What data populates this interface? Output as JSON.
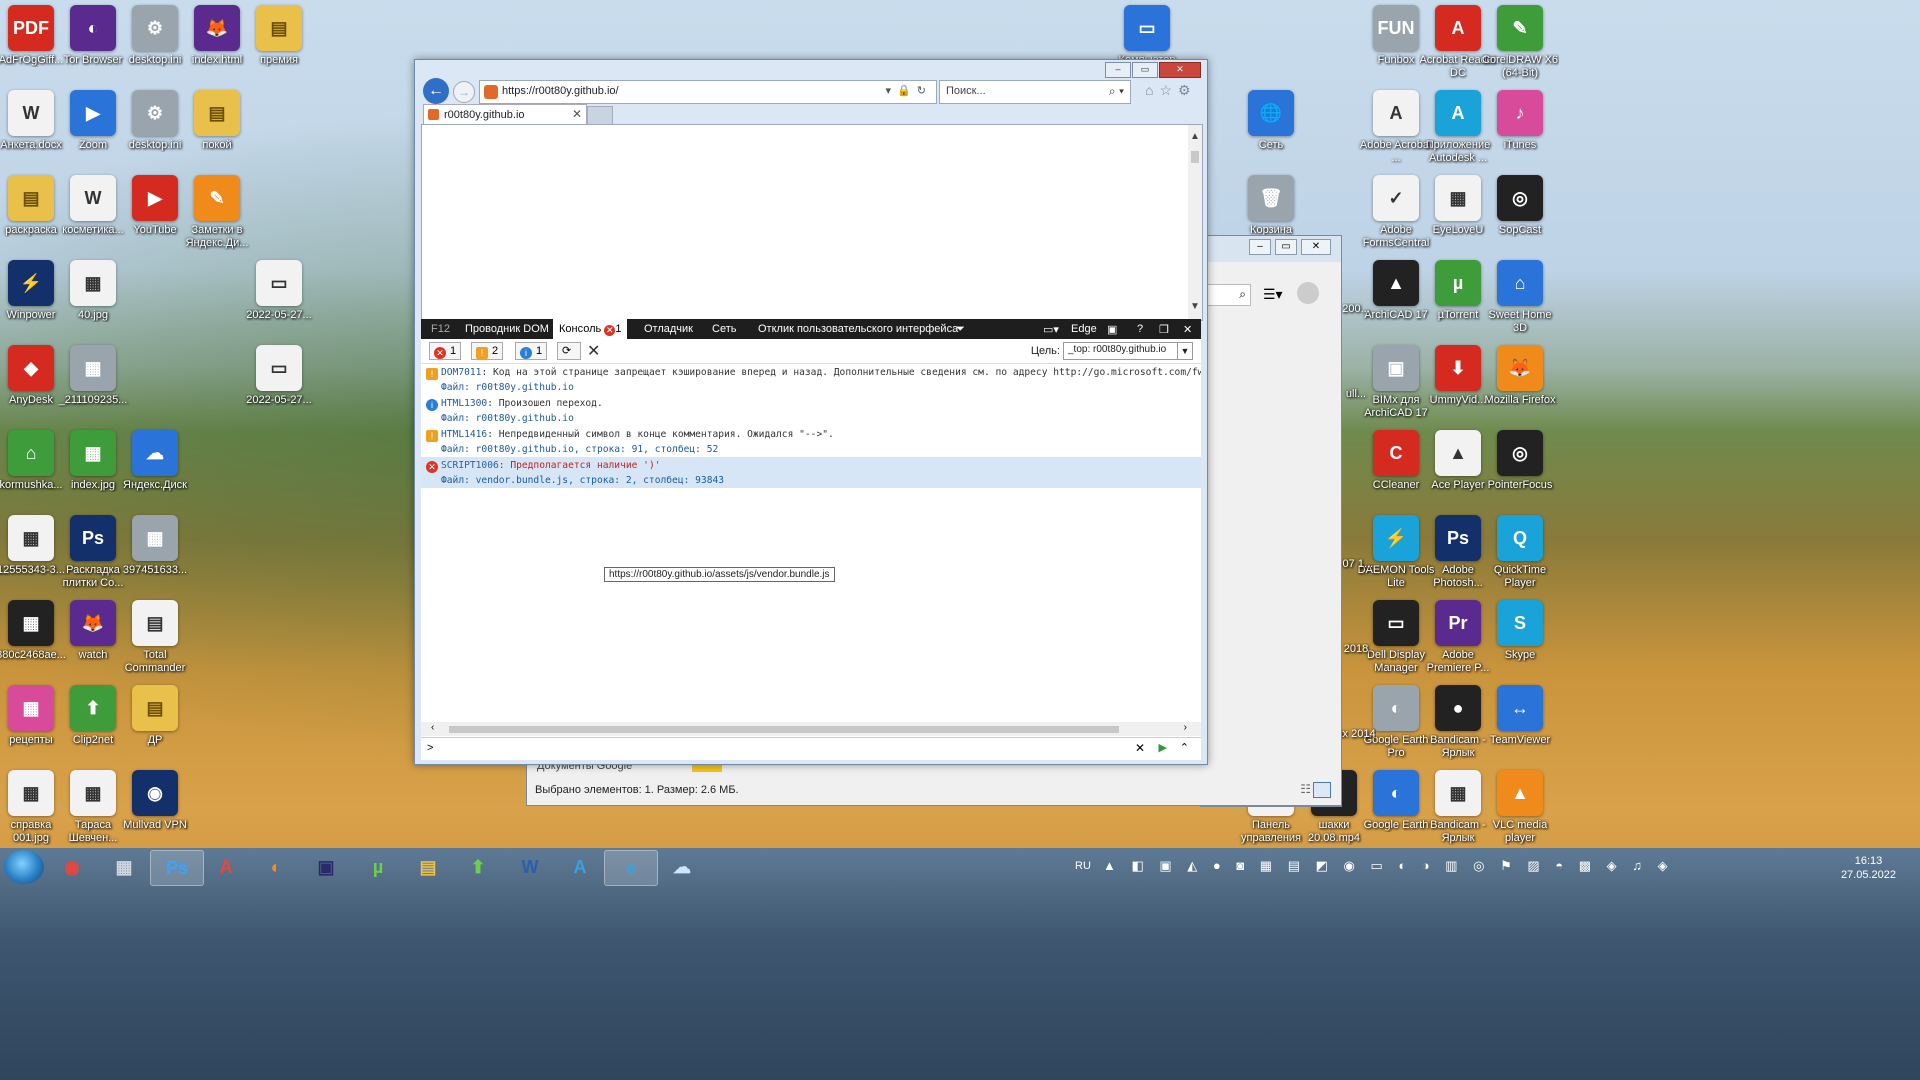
{
  "desktop_icons_left": [
    {
      "label": "AdFrOgGiff...",
      "glyph": "PDF",
      "color": "g-red"
    },
    {
      "label": "Tor Browser",
      "glyph": "◐",
      "color": "g-purple"
    },
    {
      "label": "desktop.ini",
      "glyph": "⚙",
      "color": "g-gray"
    },
    {
      "label": "index.html",
      "glyph": "🦊",
      "color": "g-purple"
    },
    {
      "label": "премия",
      "glyph": "▤",
      "color": "g-yellow"
    },
    {
      "label": "Анкета.docx",
      "glyph": "W",
      "color": "g-white"
    },
    {
      "label": "Zoom",
      "glyph": "▶",
      "color": "g-blue"
    },
    {
      "label": "desktop.ini",
      "glyph": "⚙",
      "color": "g-gray"
    },
    {
      "label": "покой",
      "glyph": "▤",
      "color": "g-yellow"
    },
    {
      "label": "раскраска",
      "glyph": "▤",
      "color": "g-yellow"
    },
    {
      "label": "косметика...",
      "glyph": "W",
      "color": "g-white"
    },
    {
      "label": "YouTube",
      "glyph": "▶",
      "color": "g-red"
    },
    {
      "label": "Заметки в Яндекс.Ди...",
      "glyph": "✎",
      "color": "g-orange"
    },
    {
      "label": "Winpower",
      "glyph": "⚡",
      "color": "g-navy"
    },
    {
      "label": "40.jpg",
      "glyph": "▦",
      "color": "g-white"
    },
    {
      "label": "2022-05-27...",
      "glyph": "▭",
      "color": "g-white"
    },
    {
      "label": "AnyDesk",
      "glyph": "◆",
      "color": "g-red"
    },
    {
      "label": "_211109235...",
      "glyph": "▦",
      "color": "g-gray"
    },
    {
      "label": "2022-05-27...",
      "glyph": "▭",
      "color": "g-white"
    },
    {
      "label": "kormushka...",
      "glyph": "⌂",
      "color": "g-green"
    },
    {
      "label": "index.jpg",
      "glyph": "▦",
      "color": "g-green"
    },
    {
      "label": "Яндекс.Диск",
      "glyph": "☁",
      "color": "g-blue"
    },
    {
      "label": "12555343-3...",
      "glyph": "▦",
      "color": "g-white"
    },
    {
      "label": "Раскладка плитки Co...",
      "glyph": "Ps",
      "color": "g-navy"
    },
    {
      "label": "397451633...",
      "glyph": "▦",
      "color": "g-gray"
    },
    {
      "label": "880c2468ae...",
      "glyph": "▦",
      "color": "g-dark"
    },
    {
      "label": "watch",
      "glyph": "🦊",
      "color": "g-purple"
    },
    {
      "label": "Total Commander",
      "glyph": "▤",
      "color": "g-white"
    },
    {
      "label": "рецепты",
      "glyph": "▦",
      "color": "g-pink"
    },
    {
      "label": "Clip2net",
      "glyph": "⬆",
      "color": "g-green"
    },
    {
      "label": "ДР",
      "glyph": "▤",
      "color": "g-yellow"
    },
    {
      "label": "справка 001.jpg",
      "glyph": "▦",
      "color": "g-white"
    },
    {
      "label": "Тараса Шевчен...",
      "glyph": "▦",
      "color": "g-white"
    },
    {
      "label": "Mullvad VPN",
      "glyph": "◉",
      "color": "g-navy"
    }
  ],
  "desktop_icons_right": [
    {
      "label": "Компьютер",
      "glyph": "▭",
      "color": "g-blue"
    },
    {
      "label": "Funbox",
      "glyph": "FUN",
      "color": "g-gray"
    },
    {
      "label": "Acrobat Reader DC",
      "glyph": "A",
      "color": "g-red"
    },
    {
      "label": "CorelDRAW X6 (64-Bit)",
      "glyph": "✎",
      "color": "g-green"
    },
    {
      "label": "Сеть",
      "glyph": "🌐",
      "color": "g-blue"
    },
    {
      "label": "Adobe Acrobat ...",
      "glyph": "A",
      "color": "g-white"
    },
    {
      "label": "Приложение Autodesk ...",
      "glyph": "A",
      "color": "g-cyan"
    },
    {
      "label": "iTunes",
      "glyph": "♪",
      "color": "g-pink"
    },
    {
      "label": "Корзина",
      "glyph": "🗑",
      "color": "g-gray"
    },
    {
      "label": "Adobe FormsCentral",
      "glyph": "✓",
      "color": "g-white"
    },
    {
      "label": "EyeLoveU",
      "glyph": "▦",
      "color": "g-white"
    },
    {
      "label": "SopCast",
      "glyph": "◎",
      "color": "g-dark"
    },
    {
      "label": "ArchiCAD 17",
      "glyph": "▲",
      "color": "g-dark"
    },
    {
      "label": "µTorrent",
      "glyph": "µ",
      "color": "g-green"
    },
    {
      "label": "Sweet Home 3D",
      "glyph": "⌂",
      "color": "g-blue"
    },
    {
      "label": "BIMx для ArchiCAD 17",
      "glyph": "▣",
      "color": "g-gray"
    },
    {
      "label": "UmmyVid...",
      "glyph": "⬇",
      "color": "g-red"
    },
    {
      "label": "Mozilla Firefox",
      "glyph": "🦊",
      "color": "g-orange"
    },
    {
      "label": "CCleaner",
      "glyph": "C",
      "color": "g-red"
    },
    {
      "label": "Ace Player",
      "glyph": "▲",
      "color": "g-white"
    },
    {
      "label": "PointerFocus",
      "glyph": "◎",
      "color": "g-dark"
    },
    {
      "label": "DAEMON Tools Lite",
      "glyph": "⚡",
      "color": "g-cyan"
    },
    {
      "label": "Adobe Photosh...",
      "glyph": "Ps",
      "color": "g-navy"
    },
    {
      "label": "QuickTime Player",
      "glyph": "Q",
      "color": "g-cyan"
    },
    {
      "label": "Dell Display Manager",
      "glyph": "▭",
      "color": "g-dark"
    },
    {
      "label": "Adobe Premiere P...",
      "glyph": "Pr",
      "color": "g-purple"
    },
    {
      "label": "Skype",
      "glyph": "S",
      "color": "g-cyan"
    },
    {
      "label": "Google Earth Pro",
      "glyph": "◐",
      "color": "g-gray"
    },
    {
      "label": "Bandicam - Ярлык",
      "glyph": "●",
      "color": "g-dark"
    },
    {
      "label": "TeamViewer",
      "glyph": "↔",
      "color": "g-blue"
    },
    {
      "label": "Панель управления",
      "glyph": "▦",
      "color": "g-white"
    },
    {
      "label": "шакки 20.08.mp4",
      "glyph": "▦",
      "color": "g-dark"
    },
    {
      "label": "Google Earth",
      "glyph": "◐",
      "color": "g-blue"
    },
    {
      "label": "Bandicam - Ярлык",
      "glyph": "▦",
      "color": "g-white"
    },
    {
      "label": "VLC media player",
      "glyph": "▲",
      "color": "g-orange"
    }
  ],
  "partial_labels": {
    "l1": "200...",
    "l2": "ull...",
    "l3": "-07 1...",
    "l4": "2018",
    "l5": "ax 2014"
  },
  "bg_window": {
    "status": "Выбрано элементов: 1. Размер: 2.6 МБ.",
    "partial_text": "Документы Google"
  },
  "ie": {
    "url": "https://r00t80y.github.io/",
    "search_placeholder": "Поиск...",
    "tab_title": "r00t80y.github.io"
  },
  "devtools": {
    "tabs": [
      "F12",
      "Проводник DOM",
      "Консоль",
      "Отладчик",
      "Сеть",
      "Отклик пользовательского интерфейса"
    ],
    "console_error_count": "1",
    "mode": "Edge",
    "filters": {
      "errors": "1",
      "warnings": "2",
      "info": "1"
    },
    "target_label": "Цель:",
    "target_value": "_top: r00t80y.github.io",
    "messages": [
      {
        "type": "warn",
        "code": "DOM7011",
        "text": ": Код на этой странице запрещает кэширование вперед и назад. Дополнительные сведения см. по адресу http://go.microsoft.com/fwlink/?Lin",
        "file": "Файл: r00t80y.github.io"
      },
      {
        "type": "info",
        "code": "HTML1300",
        "text": ": Произошел переход.",
        "file": "Файл: r00t80y.github.io"
      },
      {
        "type": "warn",
        "code": "HTML1416",
        "text": ": Непредвиденный символ в конце комментария. Ожидался \"-->\".",
        "file": "Файл: r00t80y.github.io, строка: 91, столбец: 52"
      },
      {
        "type": "error",
        "code": "SCRIPT1006",
        "text": ": Предполагается наличие ')'",
        "file": "Файл: vendor.bundle.js, строка: 2, столбец: 93843"
      }
    ],
    "tooltip": "https://r00t80y.github.io/assets/js/vendor.bundle.js",
    "prompt": ">"
  },
  "taskbar": {
    "lang": "RU",
    "time": "16:13",
    "date": "27.05.2022",
    "apps": [
      {
        "name": "chrome",
        "glyph": "◉",
        "color": "#e8453c"
      },
      {
        "name": "calculator",
        "glyph": "▦",
        "color": "#cfd8e0"
      },
      {
        "name": "photoshop",
        "glyph": "Ps",
        "color": "#31a8ff"
      },
      {
        "name": "acrobat",
        "glyph": "A",
        "color": "#e8453c"
      },
      {
        "name": "firefox",
        "glyph": "◐",
        "color": "#ff8a1a"
      },
      {
        "name": "save",
        "glyph": "▣",
        "color": "#2a2a6a"
      },
      {
        "name": "utorrent",
        "glyph": "µ",
        "color": "#6bd04a"
      },
      {
        "name": "explorer",
        "glyph": "▤",
        "color": "#e8c04a"
      },
      {
        "name": "clip2net",
        "glyph": "⬆",
        "color": "#6bd04a"
      },
      {
        "name": "word",
        "glyph": "W",
        "color": "#2a5faa"
      },
      {
        "name": "autodesk",
        "glyph": "A",
        "color": "#3aa0e0"
      },
      {
        "name": "ie",
        "glyph": "e",
        "color": "#3aa0e0"
      },
      {
        "name": "yandex-disk",
        "glyph": "☁",
        "color": "#cfe6ff"
      }
    ]
  }
}
